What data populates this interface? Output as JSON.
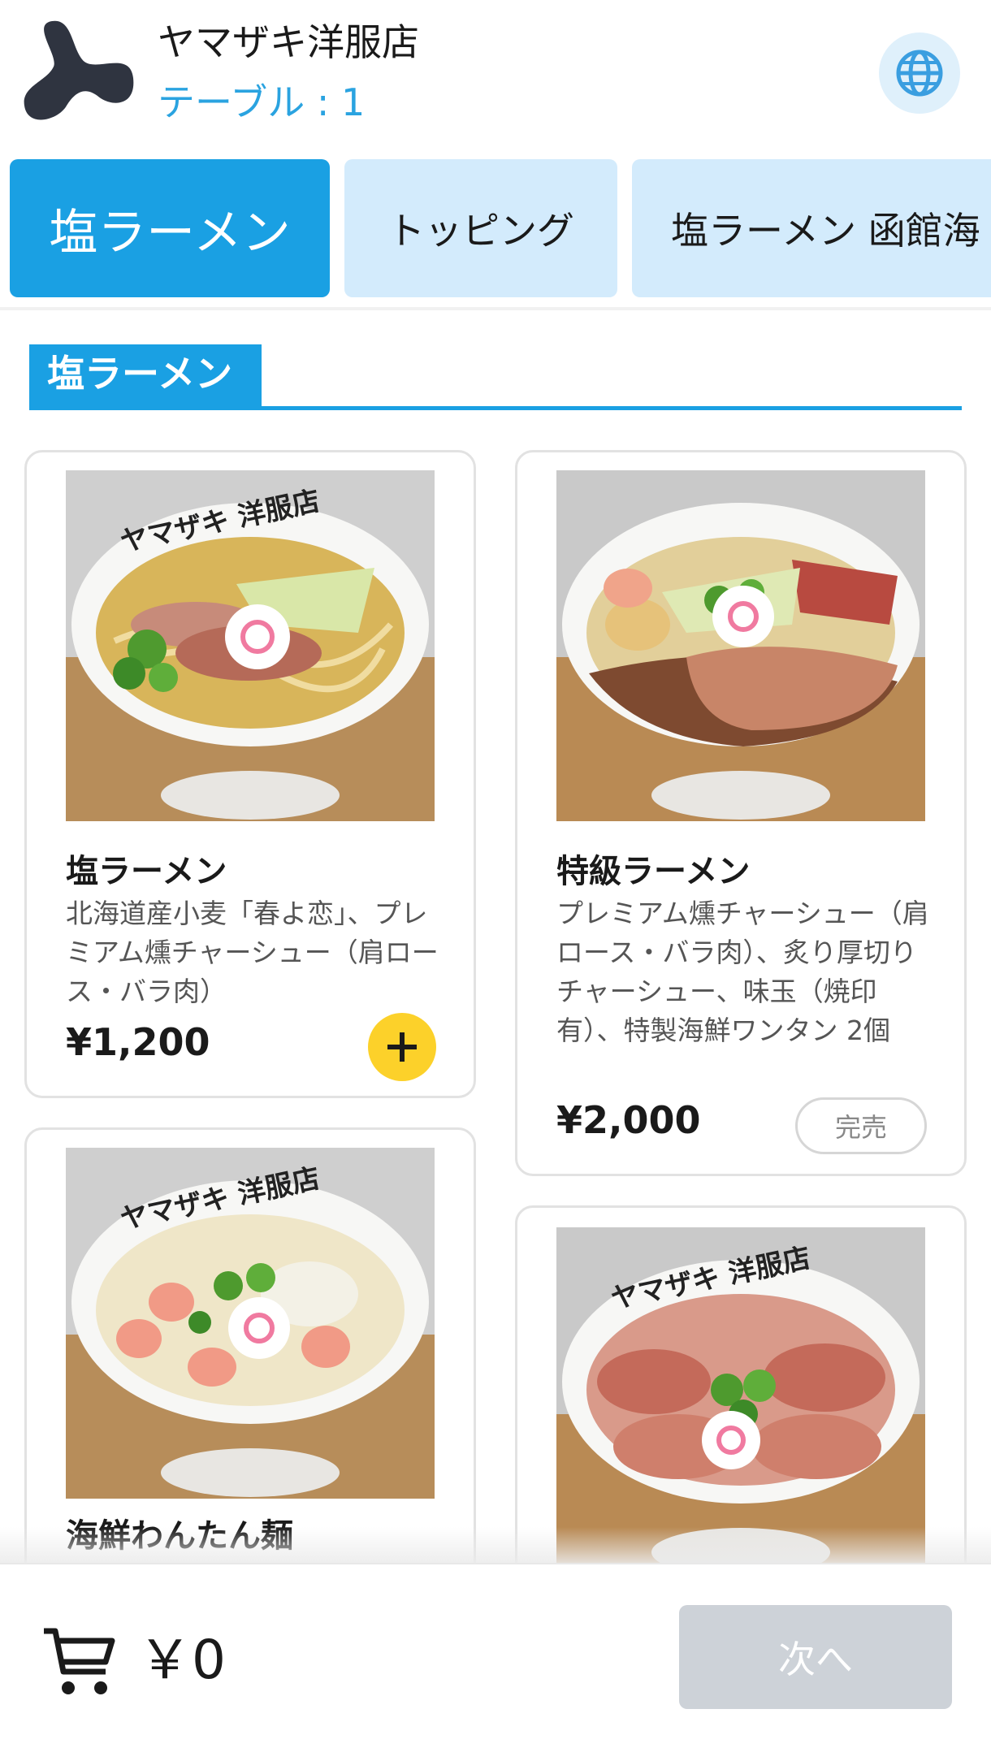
{
  "header": {
    "shop_name": "ヤマザキ洋服店",
    "table_label": "テーブル : 1",
    "language_icon": "globe-icon",
    "logo_icon": "bowtie-logo"
  },
  "tabs": [
    {
      "label": "塩ラーメン",
      "active": true
    },
    {
      "label": "トッピング",
      "active": false
    },
    {
      "label": "塩ラーメン 函館海",
      "active": false
    }
  ],
  "section": {
    "title": "塩ラーメン"
  },
  "items": [
    {
      "name": "塩ラーメン",
      "description": "北海道産小麦「春よ恋」、プレミアム燻チャーシュー（肩ロース・バラ肉）",
      "price": "¥1,200",
      "action": "add",
      "add_icon": "plus-icon"
    },
    {
      "name": "特級ラーメン",
      "description": "プレミアム燻チャーシュー（肩ロース・バラ肉）、炙り厚切りチャーシュー、味玉（焼印有）、特製海鮮ワンタン 2個",
      "price": "¥2,000",
      "action": "sold_out",
      "sold_out_label": "完売"
    },
    {
      "name": "海鮮わんたん麺",
      "action": "add"
    },
    {
      "name": "",
      "action": "add"
    }
  ],
  "bottom_bar": {
    "cart_icon": "cart-icon",
    "total": "￥0",
    "next_label": "次へ"
  },
  "colors": {
    "accent": "#1aa0e3",
    "tab_inactive": "#d3ebfc",
    "add_button": "#fcd12a",
    "next_disabled": "#cdd2d8",
    "table_text": "#2aa3e0"
  }
}
